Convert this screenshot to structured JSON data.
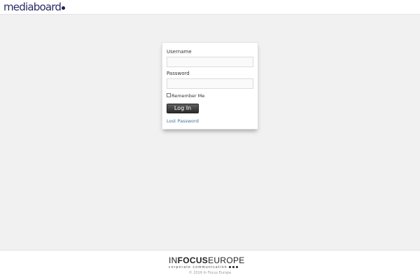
{
  "header": {
    "logo_text": "mediaboard"
  },
  "login": {
    "username_label": "Username",
    "username_value": "",
    "password_label": "Password",
    "password_value": "",
    "remember_label": "Remember Me",
    "remember_checked": false,
    "submit_label": "Log In",
    "lost_password_label": "Lost Password"
  },
  "footer": {
    "brand_light_1": "IN",
    "brand_bold": "FOCUS",
    "brand_light_2": "EUROPE",
    "tagline": "corporate communication",
    "copyright": "© 2016 In Focus Europe"
  },
  "colors": {
    "background": "#f1f1f1",
    "logo": "#2a2a66",
    "link": "#3f6fa6",
    "button": "#2a2a2a"
  }
}
